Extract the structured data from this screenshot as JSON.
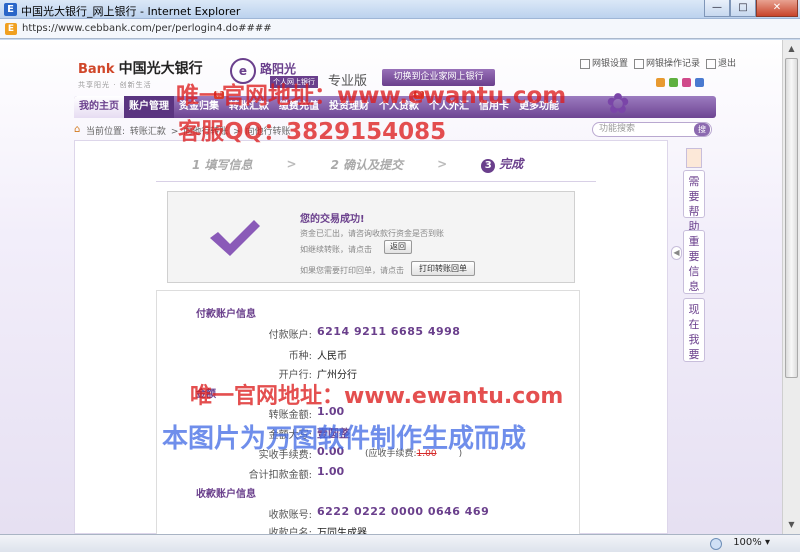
{
  "window": {
    "title": "中国光大银行_网上银行 - Internet Explorer",
    "min_label": "—",
    "max_label": "□",
    "close_label": "✕",
    "url": "https://www.cebbank.com/per/perlogin4.do####",
    "favicon": "E"
  },
  "header": {
    "brand_e": "Bank",
    "bank_name": "中国光大银行",
    "slogan": "共享阳光 · 创新生活",
    "sub_brand": "路阳光",
    "sub_tag": "个人网上银行",
    "seal": "e",
    "edition": "专业版",
    "switch_label": "切换到企业家网上银行",
    "links": [
      "网银设置",
      "网银操作记录",
      "退出"
    ],
    "color_dots": [
      "#e89a30",
      "#5fb040",
      "#d04a8a",
      "#4a7ad0"
    ]
  },
  "nav": {
    "items": [
      {
        "label": "我的主页",
        "badge": ""
      },
      {
        "label": "账户管理",
        "badge": ""
      },
      {
        "label": "资金归集",
        "badge": "新"
      },
      {
        "label": "转账汇款",
        "badge": ""
      },
      {
        "label": "缴费充值",
        "badge": ""
      },
      {
        "label": "投资理财",
        "badge": ""
      },
      {
        "label": "个人贷款",
        "badge": "新"
      },
      {
        "label": "个人外汇",
        "badge": ""
      },
      {
        "label": "信用卡",
        "badge": ""
      },
      {
        "label": "更多功能",
        "badge": ""
      }
    ]
  },
  "breadcrumb": {
    "prefix": "当前位置:",
    "items": [
      "转账汇款",
      ">",
      "向他行转账",
      ">",
      "向他行转账"
    ],
    "search_placeholder": "功能搜索",
    "search_icon": "搜"
  },
  "steps": {
    "step1": "1 填写信息",
    "step2": "2 确认及提交",
    "step3_num": "3",
    "step3": "完成",
    "sep": ">"
  },
  "success": {
    "title": "您的交易成功!",
    "message": "资金已汇出，请咨询收款行资金是否到账",
    "continue": "如继续转账，请点击",
    "back_button": "返回",
    "print_text": "如果您需要打印回单，请点击",
    "print_button": "打印转账回单"
  },
  "details": {
    "payer_section": "付款账户信息",
    "payer_account_label": "付款账户:",
    "payer_account": "6214 9211 6685 4998",
    "currency_label": "币种:",
    "currency": "人民币",
    "branch_label": "开户行:",
    "branch": "广州分行",
    "amount_section": "金额",
    "amount_label": "转账金额:",
    "amount": "1.00",
    "amount_upper_label": "金额大写:",
    "amount_upper": "壹圆整",
    "fee_label": "实收手续费:",
    "fee": "0.00",
    "fee_note_prefix": "(应收手续费:",
    "fee_note_value": "1.00",
    "fee_note_suffix": ")",
    "total_label": "合计扣款金额:",
    "total": "1.00",
    "payee_section": "收款账户信息",
    "payee_account_label": "收款账号:",
    "payee_account": "6222 0222 0000 0646 469",
    "payee_name_label": "收款户名:",
    "payee_name": "万同生成器"
  },
  "side": {
    "help": [
      "需",
      "要",
      "帮",
      "助"
    ],
    "important": [
      "重",
      "要",
      "信",
      "息"
    ],
    "now": [
      "现",
      "在",
      "我",
      "要"
    ],
    "arrow": "◀"
  },
  "status": {
    "zoom": "100%",
    "zoom_arrow": "▾"
  },
  "watermarks": {
    "line1": "唯一官网地址：www.ewantu.com",
    "line2": "客服QQ：3829154085",
    "line3": "唯一官网地址：www.ewantu.com",
    "line4": "本图片为万图软件制作生成而成"
  }
}
